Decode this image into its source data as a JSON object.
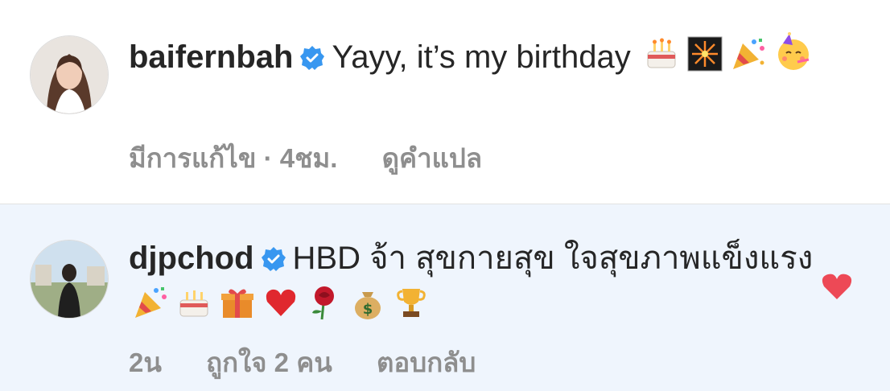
{
  "comments": [
    {
      "username": "baifernbah",
      "text": "Yayy, it’s my birthday",
      "emojis": [
        "cake-icon",
        "fireworks-icon",
        "party-popper-icon",
        "partying-face-icon"
      ],
      "edited_label": "มีการแก้ไข",
      "separator": "·",
      "time": "4ชม.",
      "translate_label": "ดูคำแปล"
    },
    {
      "username": "djpchod",
      "text": "HBD จ้า สุขกายสุข ใจสุขภาพแข็งแรง",
      "emojis": [
        "party-popper-icon",
        "cake-icon",
        "gift-icon",
        "heart-icon",
        "rose-icon",
        "money-bag-icon",
        "trophy-icon"
      ],
      "time": "2น",
      "likes_label": "ถูกใจ 2 คน",
      "reply_label": "ตอบกลับ",
      "liked": true
    }
  ],
  "colors": {
    "verified": "#3897f0",
    "meta": "#8e8e8e",
    "heart": "#ed4956",
    "highlight_bg": "#eff5fd"
  }
}
